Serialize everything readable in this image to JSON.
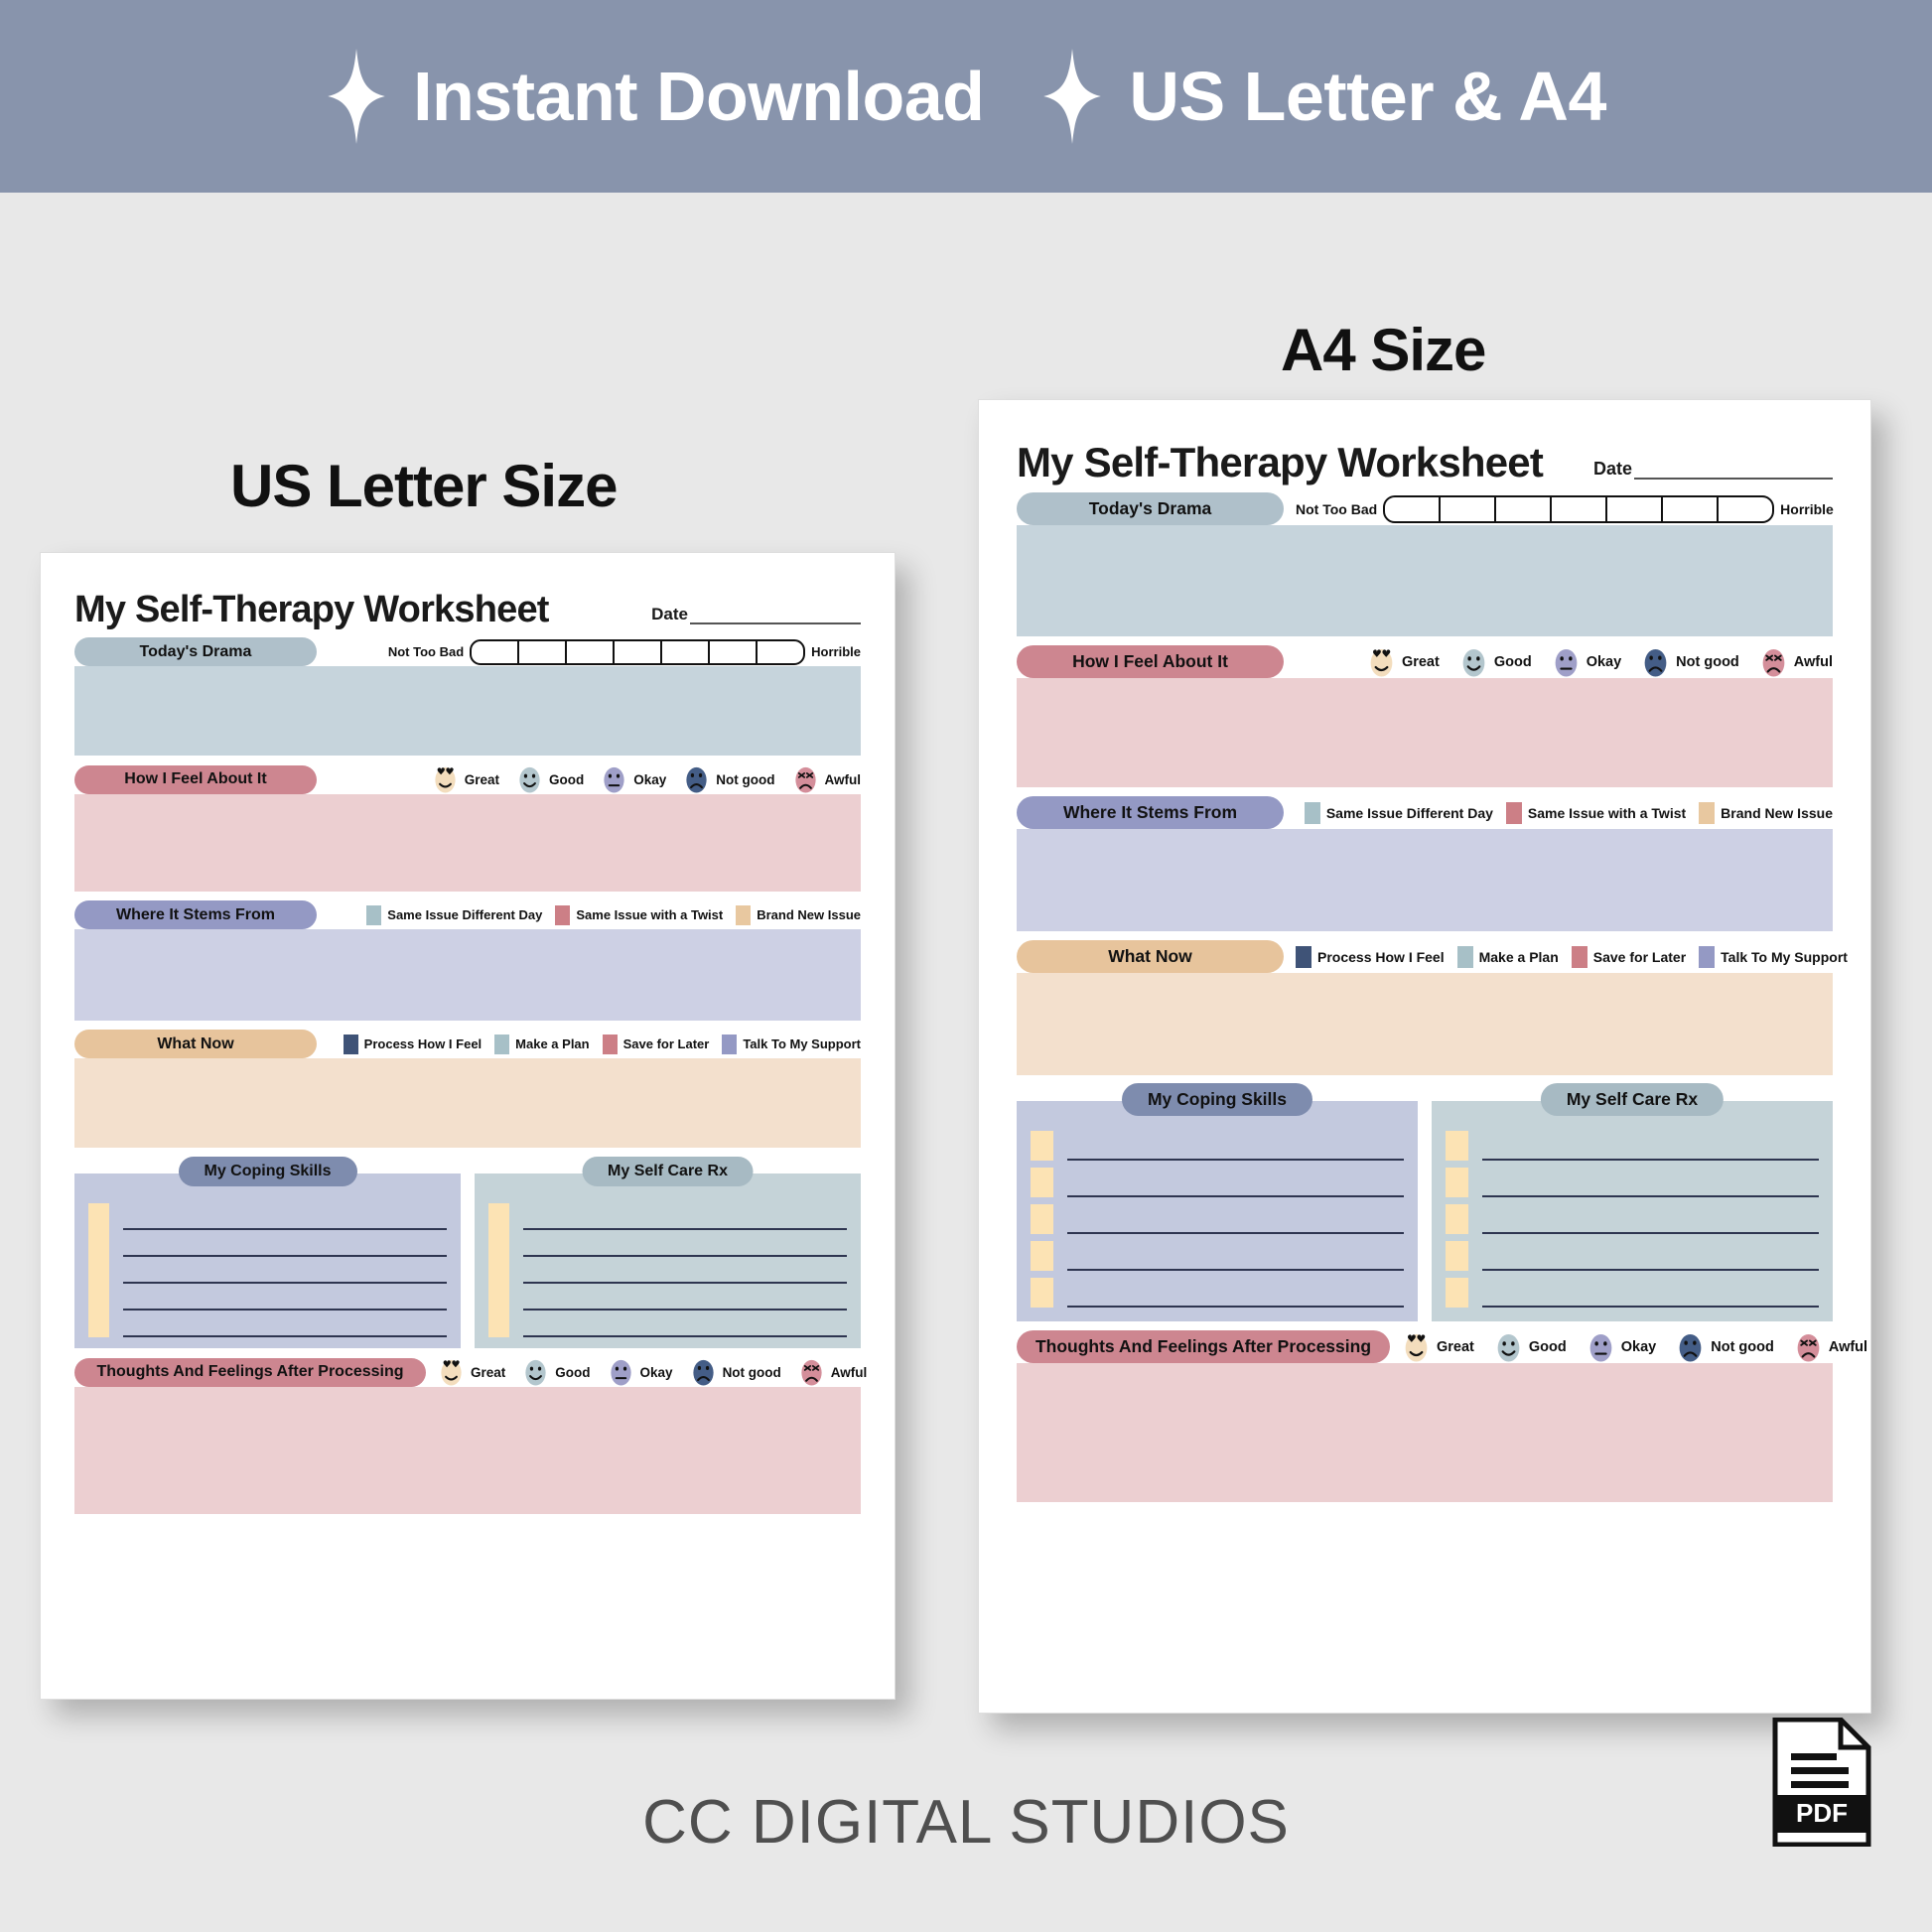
{
  "banner": {
    "items": [
      {
        "icon": "sparkle-icon",
        "text": "Instant Download"
      },
      {
        "icon": "sparkle-icon",
        "text": "US Letter & A4"
      }
    ],
    "background": "#8894ac",
    "text_color": "#ffffff"
  },
  "captions": {
    "letter": "US Letter Size",
    "a4": "A4 Size"
  },
  "worksheet": {
    "title": "My Self-Therapy Worksheet",
    "date_label": "Date",
    "sections": {
      "drama": {
        "pill_label": "Today's Drama",
        "pill_color": "#afc0ca",
        "body_color": "#c6d4dc",
        "scale_low": "Not Too Bad",
        "scale_high": "Horrible",
        "scale_segments": 7
      },
      "feel": {
        "pill_label": "How I Feel About It",
        "pill_color": "#cd8690",
        "body_color": "#eccfd1"
      },
      "stems": {
        "pill_label": "Where It Stems From",
        "pill_color": "#9499c4",
        "body_color": "#cdd0e4",
        "legend": [
          {
            "label": "Same Issue Different Day",
            "color": "#a7c0c7"
          },
          {
            "label": "Same Issue with a Twist",
            "color": "#cc7f86"
          },
          {
            "label": "Brand New Issue",
            "color": "#e8c8a0"
          }
        ]
      },
      "what_now": {
        "pill_label": "What Now",
        "pill_color": "#e7c49c",
        "body_color": "#f3e0cd",
        "legend": [
          {
            "label": "Process How I Feel",
            "color": "#3f5377"
          },
          {
            "label": "Make a Plan",
            "color": "#a7c0c7"
          },
          {
            "label": "Save for Later",
            "color": "#cc7f86"
          },
          {
            "label": "Talk To My Support",
            "color": "#9499c4"
          }
        ]
      },
      "coping": {
        "pill_label": "My Coping Skills",
        "pill_color": "#7e8cae",
        "body_color": "#c3c9de",
        "rows": 5
      },
      "selfcare": {
        "pill_label": "My Self Care Rx",
        "pill_color": "#a7bac3",
        "body_color": "#c5d3d8",
        "rows": 5
      },
      "after": {
        "pill_label": "Thoughts And Feelings After Processing",
        "pill_color": "#cd8690",
        "body_color": "#eccfd1"
      }
    },
    "moods": [
      {
        "label": "Great",
        "face": "heart-eyes-smile-icon",
        "color": "#f3ddbd"
      },
      {
        "label": "Good",
        "face": "smile-icon",
        "color": "#b3c6cd"
      },
      {
        "label": "Okay",
        "face": "neutral-icon",
        "color": "#9f9fc8"
      },
      {
        "label": "Not good",
        "face": "frown-icon",
        "color": "#445d86"
      },
      {
        "label": "Awful",
        "face": "very-sad-icon",
        "color": "#d48e9a"
      }
    ]
  },
  "footer": {
    "brand": "CC DIGITAL STUDIOS",
    "badge_label": "PDF"
  }
}
